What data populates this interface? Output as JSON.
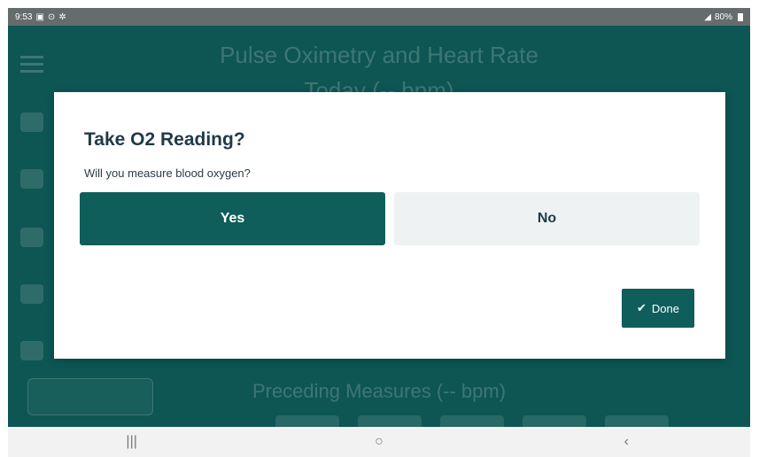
{
  "status_bar": {
    "time": "9:53",
    "battery_text": "80%"
  },
  "background": {
    "title_line1": "Pulse Oximetry and Heart Rate",
    "title_line2": "Today (-- bpm)",
    "section_title": "Preceding Measures (-- bpm)"
  },
  "dialog": {
    "title": "Take O2 Reading?",
    "question": "Will you measure blood oxygen?",
    "yes_label": "Yes",
    "no_label": "No",
    "done_label": "Done"
  },
  "nav_bar": {
    "recents_glyph": "|||",
    "home_glyph": "○",
    "back_glyph": "‹"
  },
  "colors": {
    "primary": "#0f5e5b",
    "secondary_button": "#eef2f3",
    "title_text": "#1f3a47"
  }
}
